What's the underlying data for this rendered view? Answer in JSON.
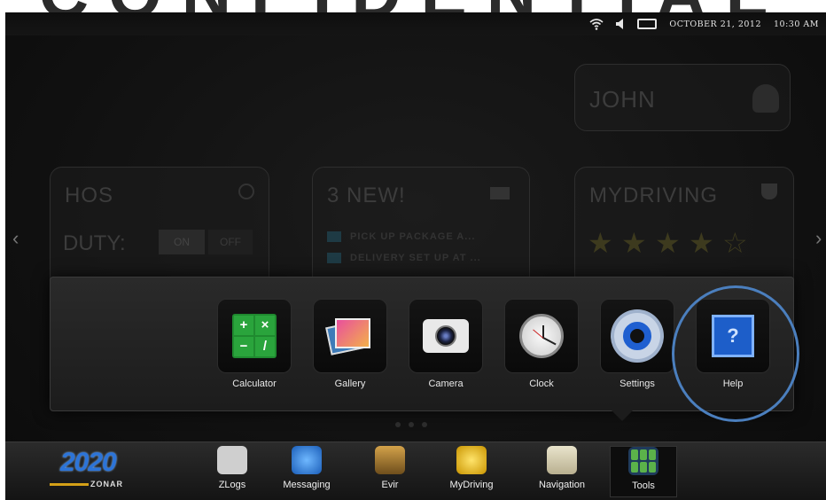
{
  "watermark": {
    "text": "CONFIDENTIAL"
  },
  "status_bar": {
    "date": "OCTOBER 21, 2012",
    "time": "10:30 AM",
    "icons": [
      "wifi-icon",
      "speaker-icon",
      "battery-icon"
    ]
  },
  "dashboard": {
    "user_name": "JOHN",
    "hos": {
      "title": "HOS",
      "duty_label": "DUTY:",
      "on": "ON",
      "off": "OFF"
    },
    "messages": {
      "title": "3 NEW!",
      "items": [
        "PICK UP PACKAGE A...",
        "DELIVERY SET UP AT ..."
      ]
    },
    "mydriving": {
      "title": "MYDRIVING",
      "rating": 4.5,
      "max_rating": 5
    }
  },
  "tools_panel": {
    "apps": [
      {
        "label": "Calculator",
        "icon": "calculator-icon"
      },
      {
        "label": "Gallery",
        "icon": "gallery-icon"
      },
      {
        "label": "Camera",
        "icon": "camera-icon"
      },
      {
        "label": "Clock",
        "icon": "clock-icon"
      },
      {
        "label": "Settings",
        "icon": "gear-icon"
      },
      {
        "label": "Help",
        "icon": "help-icon"
      }
    ],
    "highlighted": "Help"
  },
  "taskbar": {
    "brand": {
      "number": "2020",
      "name": "ZONAR"
    },
    "items": [
      {
        "label": "ZLogs",
        "icon": "zlogs-icon"
      },
      {
        "label": "Messaging",
        "icon": "messaging-icon"
      },
      {
        "label": "Evir",
        "icon": "evir-icon"
      },
      {
        "label": "MyDriving",
        "icon": "mydriving-icon"
      },
      {
        "label": "Navigation",
        "icon": "navigation-icon"
      },
      {
        "label": "Tools",
        "icon": "tools-icon"
      }
    ],
    "active": "Tools"
  },
  "colors": {
    "accent": "#1d5ec9",
    "highlight_ring": "#4b7fbe",
    "background": "#111111"
  }
}
